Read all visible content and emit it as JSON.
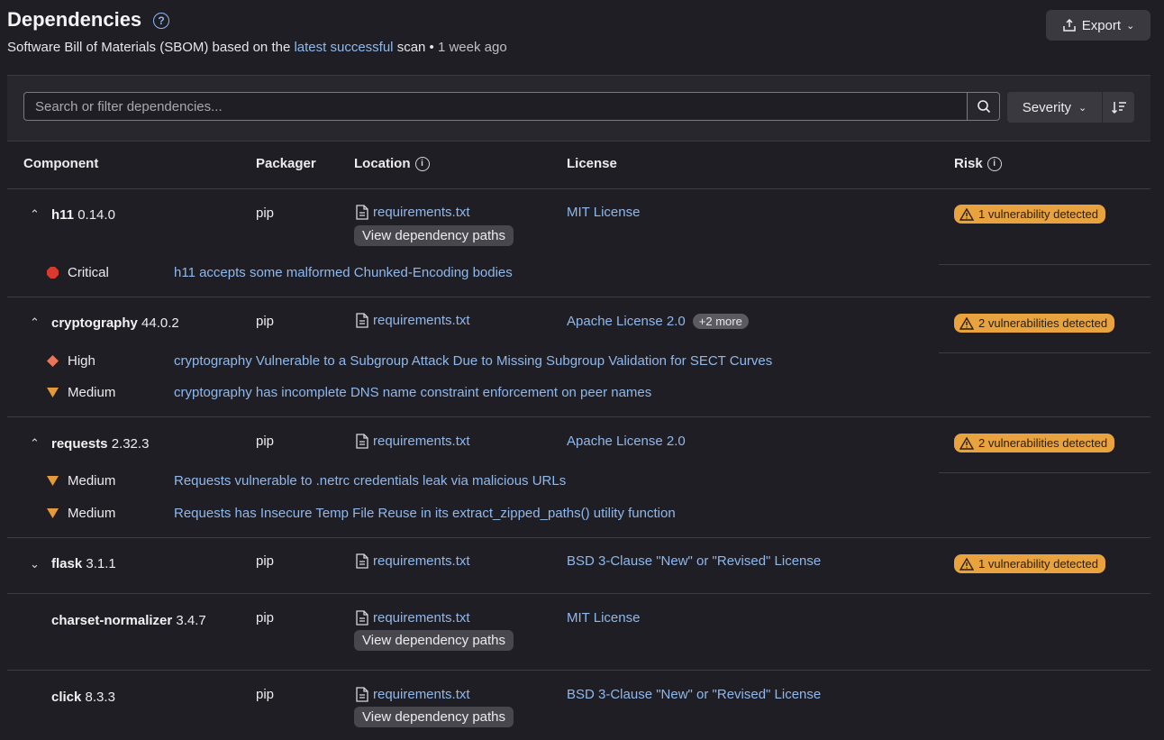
{
  "header": {
    "title": "Dependencies",
    "subtitle_prefix": "Software Bill of Materials (SBOM) based on the",
    "subtitle_link": "latest successful",
    "subtitle_mid": "scan •",
    "subtitle_time": "1 week ago",
    "export_label": "Export"
  },
  "filter": {
    "search_placeholder": "Search or filter dependencies...",
    "sort_label": "Severity"
  },
  "columns": {
    "component": "Component",
    "packager": "Packager",
    "location": "Location",
    "license": "License",
    "risk": "Risk"
  },
  "common": {
    "view_paths": "View dependency paths",
    "location_file": "requirements.txt",
    "packager": "pip"
  },
  "rows": [
    {
      "name": "h11",
      "version": "0.14.0",
      "license": "MIT License",
      "risk": "1 vulnerability detected",
      "vulns": [
        {
          "severity": "Critical",
          "title": "h11 accepts some malformed Chunked-Encoding bodies"
        }
      ]
    },
    {
      "name": "cryptography",
      "version": "44.0.2",
      "license": "Apache License 2.0",
      "license_more": "+2 more",
      "risk": "2 vulnerabilities detected",
      "vulns": [
        {
          "severity": "High",
          "title": "cryptography Vulnerable to a Subgroup Attack Due to Missing Subgroup Validation for SECT Curves"
        },
        {
          "severity": "Medium",
          "title": "cryptography has incomplete DNS name constraint enforcement on peer names"
        }
      ]
    },
    {
      "name": "requests",
      "version": "2.32.3",
      "license": "Apache License 2.0",
      "risk": "2 vulnerabilities detected",
      "vulns": [
        {
          "severity": "Medium",
          "title": "Requests vulnerable to .netrc credentials leak via malicious URLs"
        },
        {
          "severity": "Medium",
          "title": "Requests has Insecure Temp File Reuse in its extract_zipped_paths() utility function"
        }
      ]
    },
    {
      "name": "flask",
      "version": "3.1.1",
      "license": "BSD 3-Clause \"New\" or \"Revised\" License",
      "risk": "1 vulnerability detected"
    },
    {
      "name": "charset-normalizer",
      "version": "3.4.7",
      "license": "MIT License"
    },
    {
      "name": "click",
      "version": "8.3.3",
      "license": "BSD 3-Clause \"New\" or \"Revised\" License"
    }
  ],
  "colors": {
    "critical": "#d93a2f",
    "high": "#e8765a",
    "medium": "#e39a3b",
    "link": "#8fb8ec",
    "risk_badge": "#e8a23e"
  }
}
